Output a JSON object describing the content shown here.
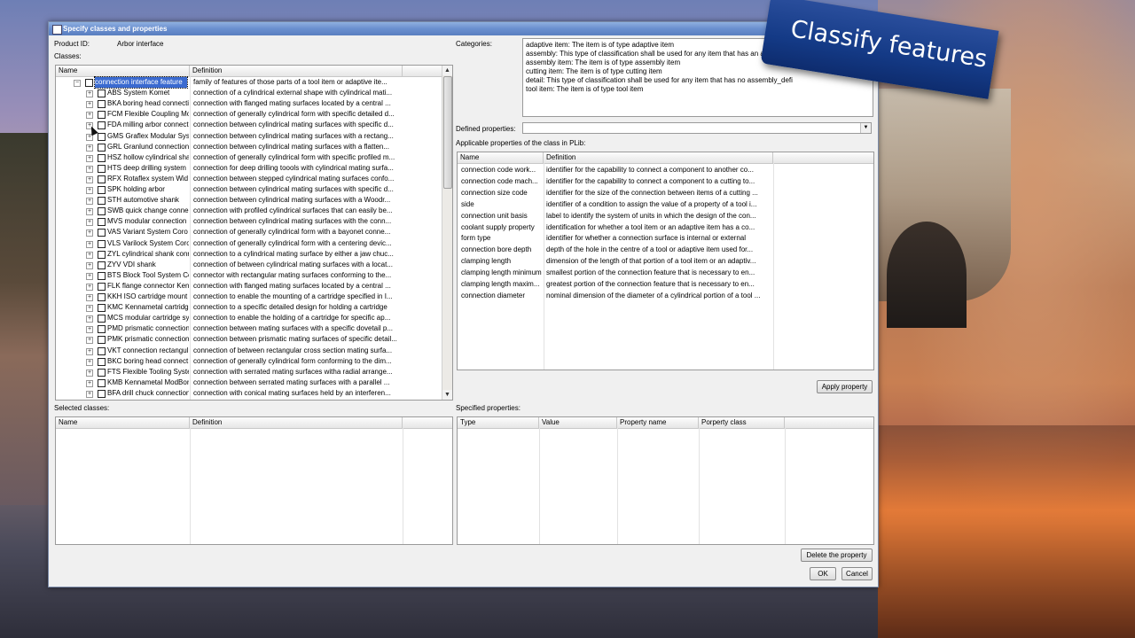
{
  "window": {
    "title": "Specify classes and properties"
  },
  "banner": {
    "text": "Classify features"
  },
  "product": {
    "label": "Product ID:",
    "value": "Arbor interface"
  },
  "classes": {
    "label": "Classes:",
    "columns": [
      "Name",
      "Definition"
    ],
    "root": {
      "name": "connection interface feature",
      "definition": "family of features of those parts of a tool item or adaptive ite..."
    },
    "items": [
      {
        "name": "ABS System Komet",
        "definition": "connection of a cylindrical external shape with cylindrical mati..."
      },
      {
        "name": "BKA boring head connecti",
        "definition": "connection with flanged mating surfaces located by a central ..."
      },
      {
        "name": "FCM Flexible Coupling Mo",
        "definition": "connection of generally cylindrical form with specific detailed d..."
      },
      {
        "name": "FDA milling arbor connect",
        "definition": "connection between cylindrical mating surfaces with specific d..."
      },
      {
        "name": "GMS Graflex Modular Sys",
        "definition": "connection between cylindrical mating surfaces with a rectang..."
      },
      {
        "name": "GRL Granlund connection",
        "definition": "connection between cylindrical mating surfaces with a flatten..."
      },
      {
        "name": "HSZ hollow cylindrical sha",
        "definition": "connection of generally cylindrical form with specific profiled m..."
      },
      {
        "name": "HTS deep drilling system",
        "definition": "connection for deep drilling toools with cylindrical mating surfa..."
      },
      {
        "name": "RFX Rotaflex system Wid",
        "definition": "connection between stepped cylindrical mating surfaces confo..."
      },
      {
        "name": "SPK holding arbor",
        "definition": "connection between cylindrical mating surfaces with specific d..."
      },
      {
        "name": "STH automotive shank",
        "definition": "connection between cylindrical mating surfaces with a Woodr..."
      },
      {
        "name": "SWB quick change conne",
        "definition": "connection with profiled cylindrical surfaces that can easily be..."
      },
      {
        "name": "MVS modular connection",
        "definition": "connection between cylindrical mating surfaces with the conn..."
      },
      {
        "name": "VAS Variant System Coro",
        "definition": "connection of generally cylindrical form with a bayonet conne..."
      },
      {
        "name": "VLS Varilock System Coro",
        "definition": "connection of generally cylindrical form with a centering devic..."
      },
      {
        "name": "ZYL cylindrical shank conr",
        "definition": "connection to a cylindrical mating surface by either a jaw chuc..."
      },
      {
        "name": "ZYV VDI shank",
        "definition": "connection of between cylindrical mating surfaces with a locat..."
      },
      {
        "name": "BTS Block Tool System Co",
        "definition": "connector with rectangular mating surfaces conforming to the..."
      },
      {
        "name": "FLK flange connector Ken",
        "definition": "connection with flanged mating surfaces located by a central ..."
      },
      {
        "name": "KKH ISO cartridge mount",
        "definition": "connection to enable the mounting of a cartridge specified in I..."
      },
      {
        "name": "KMC Kennametal cartridg",
        "definition": "connection to a specific detailed design for holding a cartridge"
      },
      {
        "name": "MCS modular cartridge sy",
        "definition": "connection to enable the holding of a cartridge for specific ap..."
      },
      {
        "name": "PMD prismatic connection",
        "definition": "connection between mating surfaces with a specific dovetail p..."
      },
      {
        "name": "PMK prismatic connection",
        "definition": "connection between prismatic mating surfaces of specific detail..."
      },
      {
        "name": "VKT connection rectangul",
        "definition": "connection of between rectangular cross section mating surfa..."
      },
      {
        "name": "BKC boring head connect",
        "definition": "connection of generally cylindrical form conforming to the dim..."
      },
      {
        "name": "FTS Flexible Tooling Syste",
        "definition": "connection with serrated mating surfaces witha radial arrange..."
      },
      {
        "name": "KMB Kennametal ModBore",
        "definition": "connection between serrated mating surfaces with a parallel ..."
      },
      {
        "name": "BFA drill chuck connection",
        "definition": "connection with conical mating surfaces held by an interferen..."
      }
    ]
  },
  "categories": {
    "label": "Categories:",
    "lines": [
      "adaptive item: The item is of type adaptive item",
      "assembly: This type of classification shall be used for any item that has an a",
      "assembly item: The item is of type assembly item",
      "cutting item: The item is of type cutting item",
      "detail: This type of classification shall be used for any item that has no assembly_defi",
      "tool item: The item is of type tool item"
    ]
  },
  "defined_properties": {
    "label": "Defined properties:",
    "value": ""
  },
  "applicable": {
    "label": "Applicable properties of the class in PLib:",
    "columns": [
      "Name",
      "Definition"
    ],
    "rows": [
      {
        "name": "connection code work...",
        "definition": "identifier for the capability to connect a component to another co..."
      },
      {
        "name": "connection code mach...",
        "definition": "identifier for the capability to connect a component to a cutting to..."
      },
      {
        "name": "connection size code",
        "definition": "identifier for the size of the connection between items of a cutting ..."
      },
      {
        "name": "side",
        "definition": "identifier of a condition to assign the value of a property of a tool i..."
      },
      {
        "name": "connection unit basis",
        "definition": "label to identify the system of units in which the design of the con..."
      },
      {
        "name": "coolant supply property",
        "definition": "identification for whether a tool item or an adaptive item has a co..."
      },
      {
        "name": "form type",
        "definition": "identifier for whether a connection surface is internal or external"
      },
      {
        "name": "connection bore depth",
        "definition": "depth of the hole in the centre of  a tool or adaptive item used for..."
      },
      {
        "name": "clamping length",
        "definition": "dimension of the length of that portion of a tool item or an adaptiv..."
      },
      {
        "name": "clamping length minimum",
        "definition": "smallest portion of the connection feature that is necessary to en..."
      },
      {
        "name": "clamping length maxim...",
        "definition": "greatest portion of the connection feature that is necessary to en..."
      },
      {
        "name": "connection diameter",
        "definition": "nominal dimension of the diameter of a cylindrical portion of a tool ..."
      }
    ]
  },
  "buttons": {
    "apply": "Apply property",
    "delete": "Delete the property",
    "ok": "OK",
    "cancel": "Cancel"
  },
  "selected_classes": {
    "label": "Selected classes:",
    "columns": [
      "Name",
      "Definition"
    ]
  },
  "specified_properties": {
    "label": "Specified properties:",
    "columns": [
      "Type",
      "Value",
      "Property name",
      "Porperty class"
    ]
  }
}
